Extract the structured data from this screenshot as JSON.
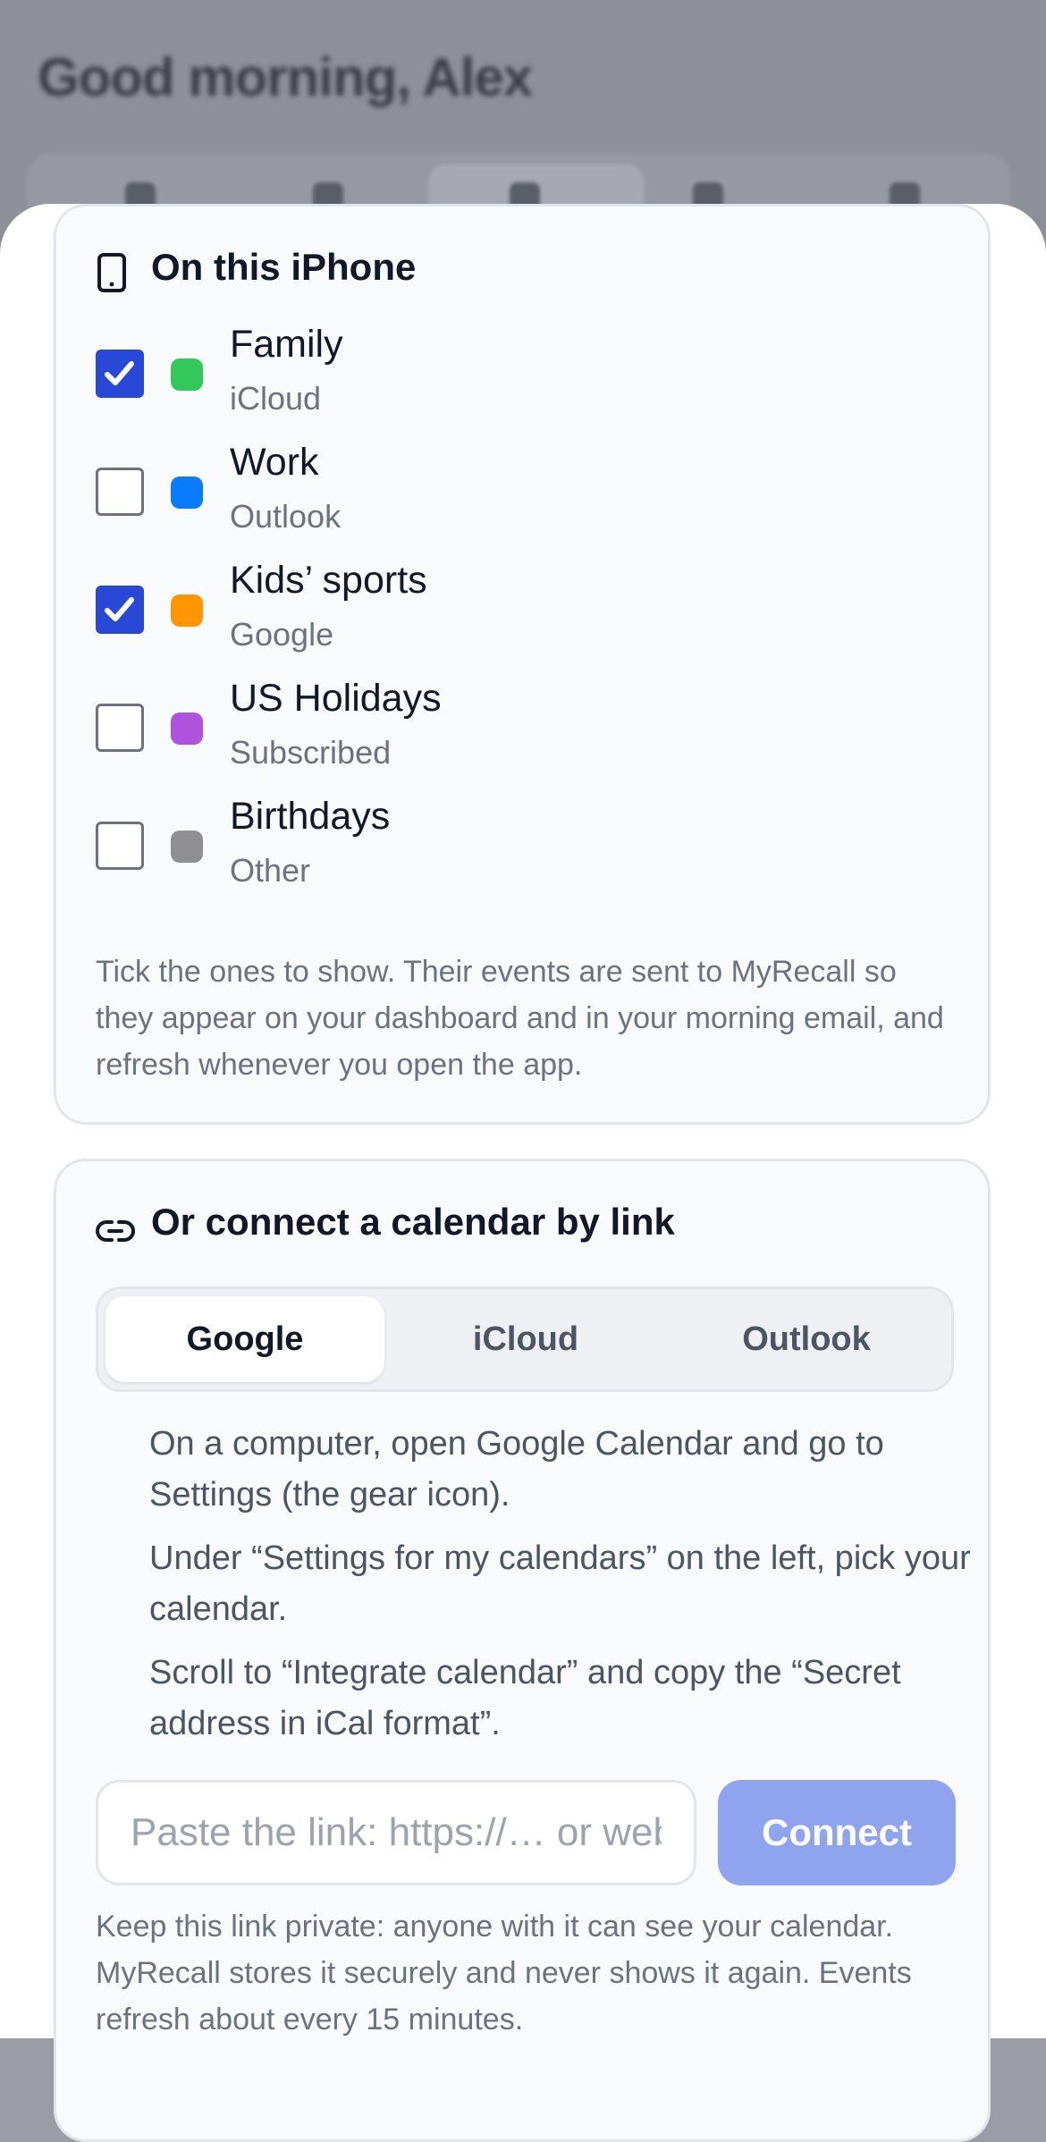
{
  "background": {
    "greeting": "Good morning, Alex"
  },
  "iphone_section": {
    "title": "On this iPhone",
    "icon": "phone-icon",
    "calendars": [
      {
        "name": "Family",
        "source": "iCloud",
        "checked": true,
        "color": "#34c759"
      },
      {
        "name": "Work",
        "source": "Outlook",
        "checked": false,
        "color": "#0a7aff"
      },
      {
        "name": "Kids’ sports",
        "source": "Google",
        "checked": true,
        "color": "#ff9500"
      },
      {
        "name": "US Holidays",
        "source": "Subscribed",
        "checked": false,
        "color": "#af52de"
      },
      {
        "name": "Birthdays",
        "source": "Other",
        "checked": false,
        "color": "#8e8e93"
      }
    ],
    "help": "Tick the ones to show. Their events are sent to MyRecall so they appear on your dashboard and in your morning email, and refresh whenever you open the app."
  },
  "link_section": {
    "title": "Or connect a calendar by link",
    "icon": "link-icon",
    "tabs": [
      {
        "label": "Google",
        "active": true
      },
      {
        "label": "iCloud",
        "active": false
      },
      {
        "label": "Outlook",
        "active": false
      }
    ],
    "steps": [
      "On a computer, open Google Calendar and go to Settings (the gear icon).",
      "Under “Settings for my calendars” on the left, pick your calendar.",
      "Scroll to “Integrate calendar” and copy the “Secret address in iCal format”."
    ],
    "input_placeholder": "Paste the link: https://… or webcal://…",
    "input_value": "",
    "connect_label": "Connect",
    "note": "Keep this link private: anyone with it can see your calendar. MyRecall stores it securely and never shows it again. Events refresh about every 15 minutes."
  },
  "colors": {
    "accent": "#2848d8",
    "connect_disabled": "#8fa3ee"
  }
}
